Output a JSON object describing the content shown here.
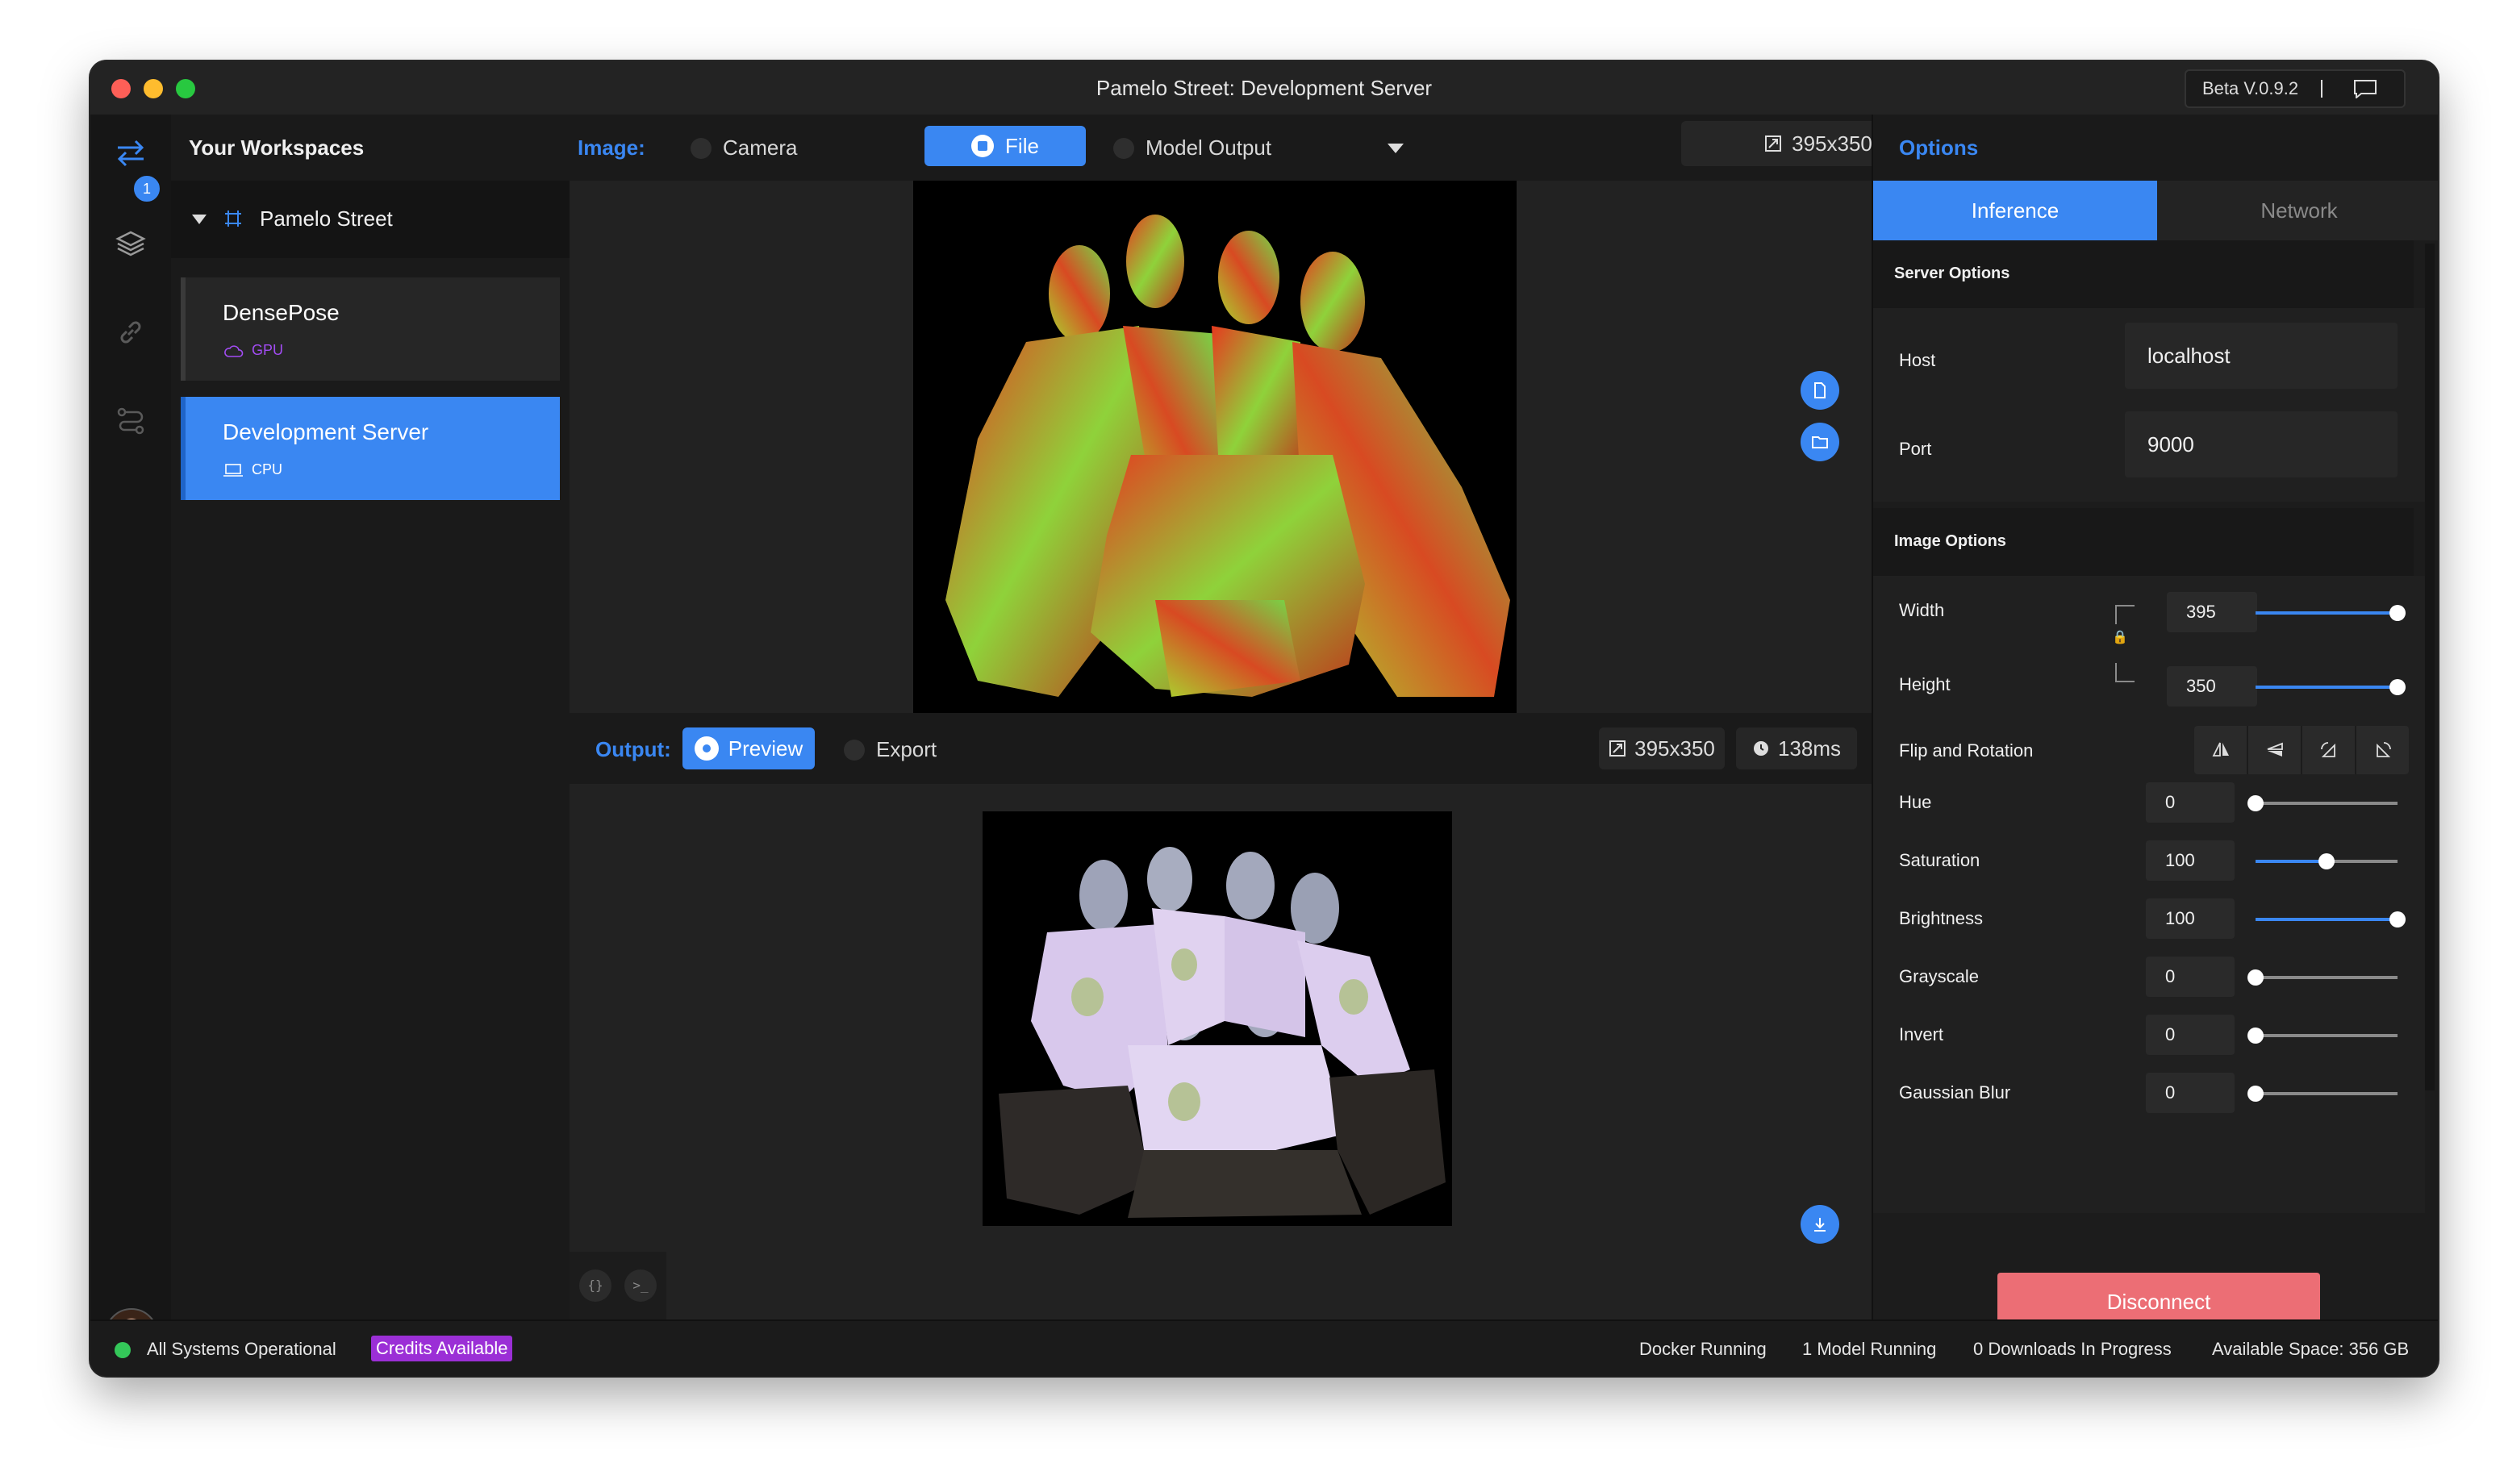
{
  "window": {
    "title": "Pamelo Street: Development Server",
    "version": "Beta V.0.9.2"
  },
  "rail": {
    "badge_count": "1",
    "icons": [
      "swap-arrows-icon",
      "layers-icon",
      "link-icon",
      "route-icon"
    ]
  },
  "workspaces": {
    "title": "Your Workspaces",
    "group": "Pamelo Street",
    "items": [
      {
        "name": "DensePose",
        "device": "GPU",
        "device_icon": "cloud-icon",
        "device_color": "#a24cf3"
      },
      {
        "name": "Development Server",
        "device": "CPU",
        "device_icon": "laptop-icon",
        "device_color": "#ffffff"
      }
    ]
  },
  "image_toolbar": {
    "label": "Image:",
    "sources": [
      "Camera",
      "File",
      "Model Output"
    ],
    "selected_source": "File",
    "size": "395x350"
  },
  "output_toolbar": {
    "label": "Output:",
    "preview": "Preview",
    "export": "Export",
    "size": "395x350",
    "latency": "138ms"
  },
  "options": {
    "title": "Options",
    "tabs": [
      "Inference",
      "Network"
    ],
    "active_tab": "Inference",
    "server_options": {
      "heading": "Server Options",
      "host_label": "Host",
      "host_value": "localhost",
      "port_label": "Port",
      "port_value": "9000"
    },
    "image_options": {
      "heading": "Image Options",
      "width_label": "Width",
      "width_value": "395",
      "width_fraction": 1.0,
      "height_label": "Height",
      "height_value": "350",
      "height_fraction": 1.0,
      "flip_label": "Flip and Rotation",
      "adjustments": [
        {
          "label": "Hue",
          "value": "0",
          "fraction": 0.0
        },
        {
          "label": "Saturation",
          "value": "100",
          "fraction": 0.5
        },
        {
          "label": "Brightness",
          "value": "100",
          "fraction": 1.0
        },
        {
          "label": "Grayscale",
          "value": "0",
          "fraction": 0.0
        },
        {
          "label": "Invert",
          "value": "0",
          "fraction": 0.0
        },
        {
          "label": "Gaussian Blur",
          "value": "0",
          "fraction": 0.0
        }
      ]
    },
    "disconnect": "Disconnect"
  },
  "status": {
    "operational": "All Systems Operational",
    "credits": "Credits Available",
    "docker": "Docker Running",
    "models": "1 Model Running",
    "downloads": "0 Downloads In Progress",
    "space": "Available Space: 356 GB"
  },
  "colors": {
    "accent": "#3a87f2",
    "disconnect": "#ec6e75",
    "credits": "#9b2fd6",
    "status_ok": "#34c759"
  }
}
